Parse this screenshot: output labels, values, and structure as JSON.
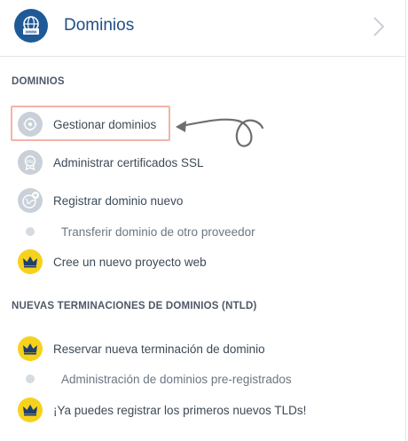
{
  "header": {
    "title": "Dominios",
    "icon": "globe-www-icon",
    "chevron": "chevron-right-icon"
  },
  "sections": [
    {
      "title": "DOMINIOS",
      "items": [
        {
          "label": "Gestionar dominios",
          "icon": "globe-gear-icon",
          "style": "gray"
        },
        {
          "label": "Administrar certificados SSL",
          "icon": "ssl-badge-icon",
          "style": "gray"
        },
        {
          "label": "Registrar dominio nuevo",
          "icon": "globe-plus-icon",
          "style": "gray"
        },
        {
          "label": "Transferir dominio de otro proveedor",
          "icon": "dot-icon",
          "style": "dot"
        },
        {
          "label": "Cree un nuevo proyecto web",
          "icon": "crown-icon",
          "style": "crown"
        }
      ]
    },
    {
      "title": "NUEVAS TERMINACIONES DE DOMINIOS (NTLD)",
      "items": [
        {
          "label": "Reservar nueva terminación de dominio",
          "icon": "crown-icon",
          "style": "crown"
        },
        {
          "label": "Administración de dominios pre-registrados",
          "icon": "dot-icon",
          "style": "dot"
        },
        {
          "label": "¡Ya puedes registrar los primeros nuevos TLDs!",
          "icon": "crown-icon",
          "style": "crown"
        }
      ]
    }
  ],
  "colors": {
    "brand": "#1f5a97",
    "title": "#1f4f86",
    "crown": "#f6d21c",
    "highlight": "#f3b3a8",
    "annotation_arrow": "#6e6e6e"
  }
}
